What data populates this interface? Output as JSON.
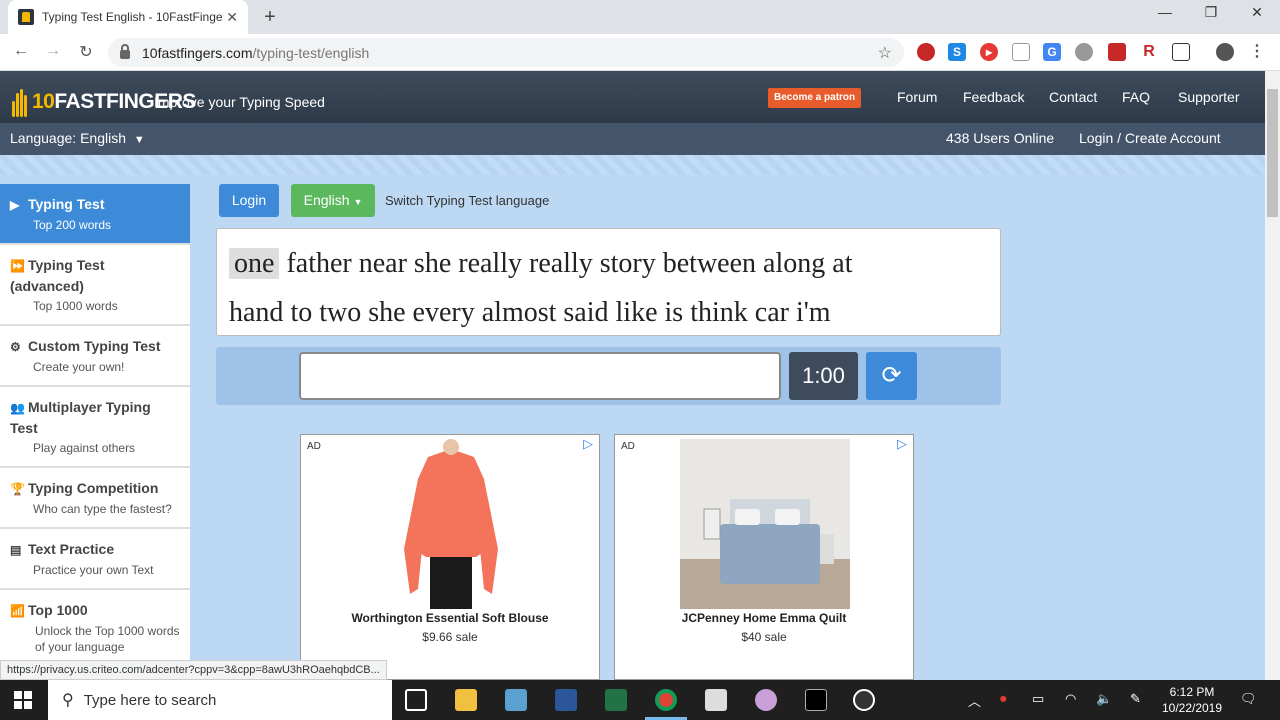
{
  "browser": {
    "tab_title": "Typing Test English - 10FastFingers",
    "url_host": "10fastfingers.com",
    "url_path": "/typing-test/english",
    "status_url": "https://privacy.us.criteo.com/adcenter?cppv=3&cpp=8awU3hROaehqbdCB..."
  },
  "header": {
    "logo_digit": "10",
    "logo_text": "FASTFINGERS",
    "tagline": "Improve your Typing Speed",
    "patron_label": "Become a patron",
    "nav": [
      "Forum",
      "Feedback",
      "Contact",
      "FAQ",
      "Supporter"
    ],
    "language_label": "Language: English",
    "users_online": "438 Users Online",
    "login_label": "Login / Create Account"
  },
  "sidebar": {
    "items": [
      {
        "title": "Typing Test",
        "sub": "Top 200 words",
        "icon": "play-icon"
      },
      {
        "title": "Typing Test (advanced)",
        "sub": "Top 1000 words",
        "icon": "fast-forward-icon"
      },
      {
        "title": "Custom Typing Test",
        "sub": "Create your own!",
        "icon": "gears-icon"
      },
      {
        "title": "Multiplayer Typing Test",
        "sub": "Play against others",
        "icon": "users-icon"
      },
      {
        "title": "Typing Competition",
        "sub": "Who can type the fastest?",
        "icon": "trophy-icon"
      },
      {
        "title": "Text Practice",
        "sub": "Practice your own Text",
        "icon": "document-icon"
      },
      {
        "title": "Top 1000",
        "sub": "Unlock the Top 1000 words of your language",
        "icon": "signal-icon"
      }
    ]
  },
  "main": {
    "login_button": "Login",
    "language_button": "English",
    "switch_label": "Switch Typing Test language",
    "words_line1": [
      "one",
      "father",
      "near",
      "she",
      "really",
      "really",
      "story",
      "between",
      "along",
      "at"
    ],
    "words_line2": [
      "hand",
      "to",
      "two",
      "she",
      "every",
      "almost",
      "said",
      "like",
      "is",
      "think",
      "car",
      "i'm"
    ],
    "input_value": "",
    "timer": "1:00"
  },
  "ads": [
    {
      "label": "AD",
      "name": "Worthington Essential Soft Blouse",
      "price": "$9.66 sale"
    },
    {
      "label": "AD",
      "name": "JCPenney Home Emma Quilt",
      "price": "$40 sale"
    }
  ],
  "taskbar": {
    "search_placeholder": "Type here to search",
    "time": "6:12 PM",
    "date": "10/22/2019"
  },
  "colors": {
    "accent_blue": "#3c8ad8",
    "green": "#5cb85c",
    "header_dark": "#3d4b5c",
    "page_bg": "#bcd8f3",
    "logo_yellow": "#f5b800"
  }
}
